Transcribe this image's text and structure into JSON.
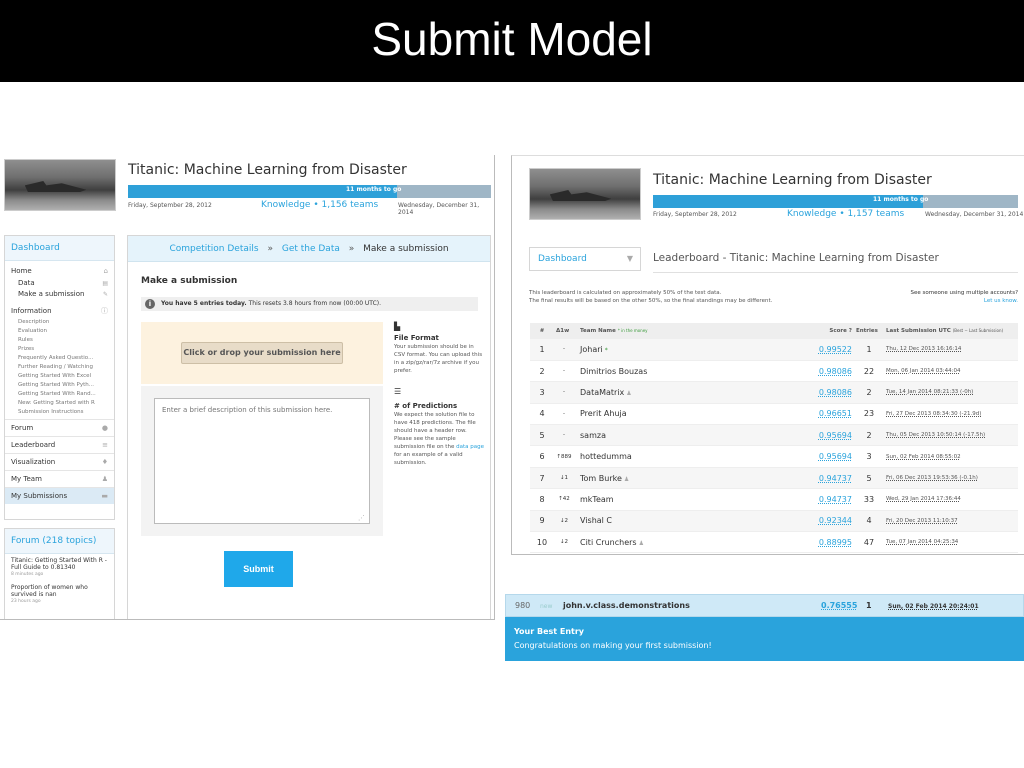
{
  "slide": {
    "title": "Submit Model"
  },
  "left_screenshot": {
    "competition": {
      "title": "Titanic: Machine Learning from Disaster",
      "progress_label": "11 months to go",
      "progress_fraction": 0.74,
      "start_date": "Friday, September 28, 2012",
      "teams": "Knowledge • 1,156 teams",
      "end_date": "Wednesday, December 31, 2014"
    },
    "sidebar": {
      "dashboard": "Dashboard",
      "home": "Home",
      "home_items": [
        "Data",
        "Make a submission"
      ],
      "information": "Information",
      "information_items": [
        "Description",
        "Evaluation",
        "Rules",
        "Prizes",
        "Frequently Asked Questio...",
        "Further Reading / Watching",
        "Getting Started With Excel",
        "Getting Started With Pyth...",
        "Getting Started With Rand...",
        "New: Getting Started with R",
        "Submission Instructions"
      ],
      "nav": [
        "Forum",
        "Leaderboard",
        "Visualization",
        "My Team",
        "My Submissions"
      ],
      "nav_icons": [
        "speech-bubble-icon",
        "list-icon",
        "pin-icon",
        "users-icon",
        "archive-icon"
      ]
    },
    "forum": {
      "heading": "Forum (218 topics)",
      "topics": [
        {
          "title": "Titanic: Getting Started With R - Full Guide to 0.81340",
          "time": "8 minutes ago"
        },
        {
          "title": "Proportion of women who survived is nan",
          "time": "23 hours ago"
        }
      ]
    },
    "breadcrumb": {
      "link1": "Competition Details",
      "sep": "»",
      "link2": "Get the Data",
      "current": "Make a submission"
    },
    "submission": {
      "heading": "Make a submission",
      "entries_bold": "You have 5 entries today.",
      "entries_rest": " This resets 3.8 hours from now (00:00 UTC).",
      "drop_label": "Click or drop your submission here",
      "description_placeholder": "Enter a brief description of this submission here.",
      "submit_label": "Submit"
    },
    "help": {
      "file_format_title": "File Format",
      "file_format_text": "Your submission should be in CSV format. You can upload this in a zip/gz/rar/7z archive if you prefer.",
      "predictions_title": "# of Predictions",
      "predictions_text_1": "We expect the solution file to have 418 predictions. The file should have a header row. Please see the sample submission file on the ",
      "predictions_link": "data page",
      "predictions_text_2": " for an example of a valid submission."
    }
  },
  "right_screenshot": {
    "competition": {
      "title": "Titanic: Machine Learning from Disaster",
      "progress_label": "11 months to go",
      "progress_fraction": 0.74,
      "start_date": "Friday, September 28, 2012",
      "teams": "Knowledge • 1,157 teams",
      "end_date": "Wednesday, December 31, 2014"
    },
    "dashboard": "Dashboard",
    "leaderboard_title": "Leaderboard - Titanic: Machine Learning from Disaster",
    "note_line1": "This leaderboard is calculated on approximately 50% of the test data.",
    "note_line2": "The final results will be based on the other 50%, so the final standings may be different.",
    "multi_account_line1": "See someone using multiple accounts?",
    "multi_account_link": "Let us know.",
    "table": {
      "headers": {
        "rank": "#",
        "delta": "Δ1w",
        "team": "Team Name",
        "team_note": "* in the money",
        "score": "Score",
        "entries": "Entries",
        "last": "Last Submission UTC",
        "last_note": "(Best − Last Submission)"
      },
      "rows": [
        {
          "rank": "1",
          "delta": "-",
          "team": "Johari",
          "star": "*",
          "score": "0.99522",
          "entries": "1",
          "last": "Thu, 12 Dec 2013 16:16:14"
        },
        {
          "rank": "2",
          "delta": "-",
          "team": "Dimitrios Bouzas",
          "score": "0.98086",
          "entries": "22",
          "last": "Mon, 06 Jan 2014 03:44:04"
        },
        {
          "rank": "3",
          "delta": "-",
          "team": "DataMatrix",
          "score": "0.98086",
          "entries": "2",
          "last": "Tue, 14 Jan 2014 08:21:33 (-0h)"
        },
        {
          "rank": "4",
          "delta": "-",
          "team": "Prerit Ahuja",
          "score": "0.96651",
          "entries": "23",
          "last": "Fri, 27 Dec 2013 08:34:30 (-21.9d)"
        },
        {
          "rank": "5",
          "delta": "-",
          "team": "samza",
          "score": "0.95694",
          "entries": "2",
          "last": "Thu, 05 Dec 2013 10:50:14 (-17.5h)"
        },
        {
          "rank": "6",
          "delta": "↑889",
          "team": "hottedumma",
          "score": "0.95694",
          "entries": "3",
          "last": "Sun, 02 Feb 2014 08:55:02"
        },
        {
          "rank": "7",
          "delta": "↓1",
          "team": "Tom Burke",
          "score": "0.94737",
          "entries": "5",
          "last": "Fri, 06 Dec 2013 19:53:36 (-0.1h)"
        },
        {
          "rank": "8",
          "delta": "↑42",
          "team": "mkTeam",
          "score": "0.94737",
          "entries": "33",
          "last": "Wed, 29 Jan 2014 17:36:44"
        },
        {
          "rank": "9",
          "delta": "↓2",
          "team": "Vishal C",
          "score": "0.92344",
          "entries": "4",
          "last": "Fri, 20 Dec 2013 11:10:37"
        },
        {
          "rank": "10",
          "delta": "↓2",
          "team": "Citi Crunchers",
          "score": "0.88995",
          "entries": "47",
          "last": "Tue, 07 Jan 2014 04:25:34"
        }
      ]
    }
  },
  "my_entry": {
    "rank": "980",
    "delta": "new",
    "team": "john.v.class.demonstrations",
    "score": "0.76555",
    "entries": "1",
    "last": "Sun, 02 Feb 2014 20:24:01",
    "best_title": "Your Best Entry",
    "best_message": "Congratulations on making your first submission!"
  },
  "colors": {
    "accent": "#2aa3dc",
    "submit": "#1fa8ea",
    "progress_fill": "#2ea0d8",
    "progress_track": "#9fb6c6",
    "drop_zone": "#fdf2df"
  }
}
